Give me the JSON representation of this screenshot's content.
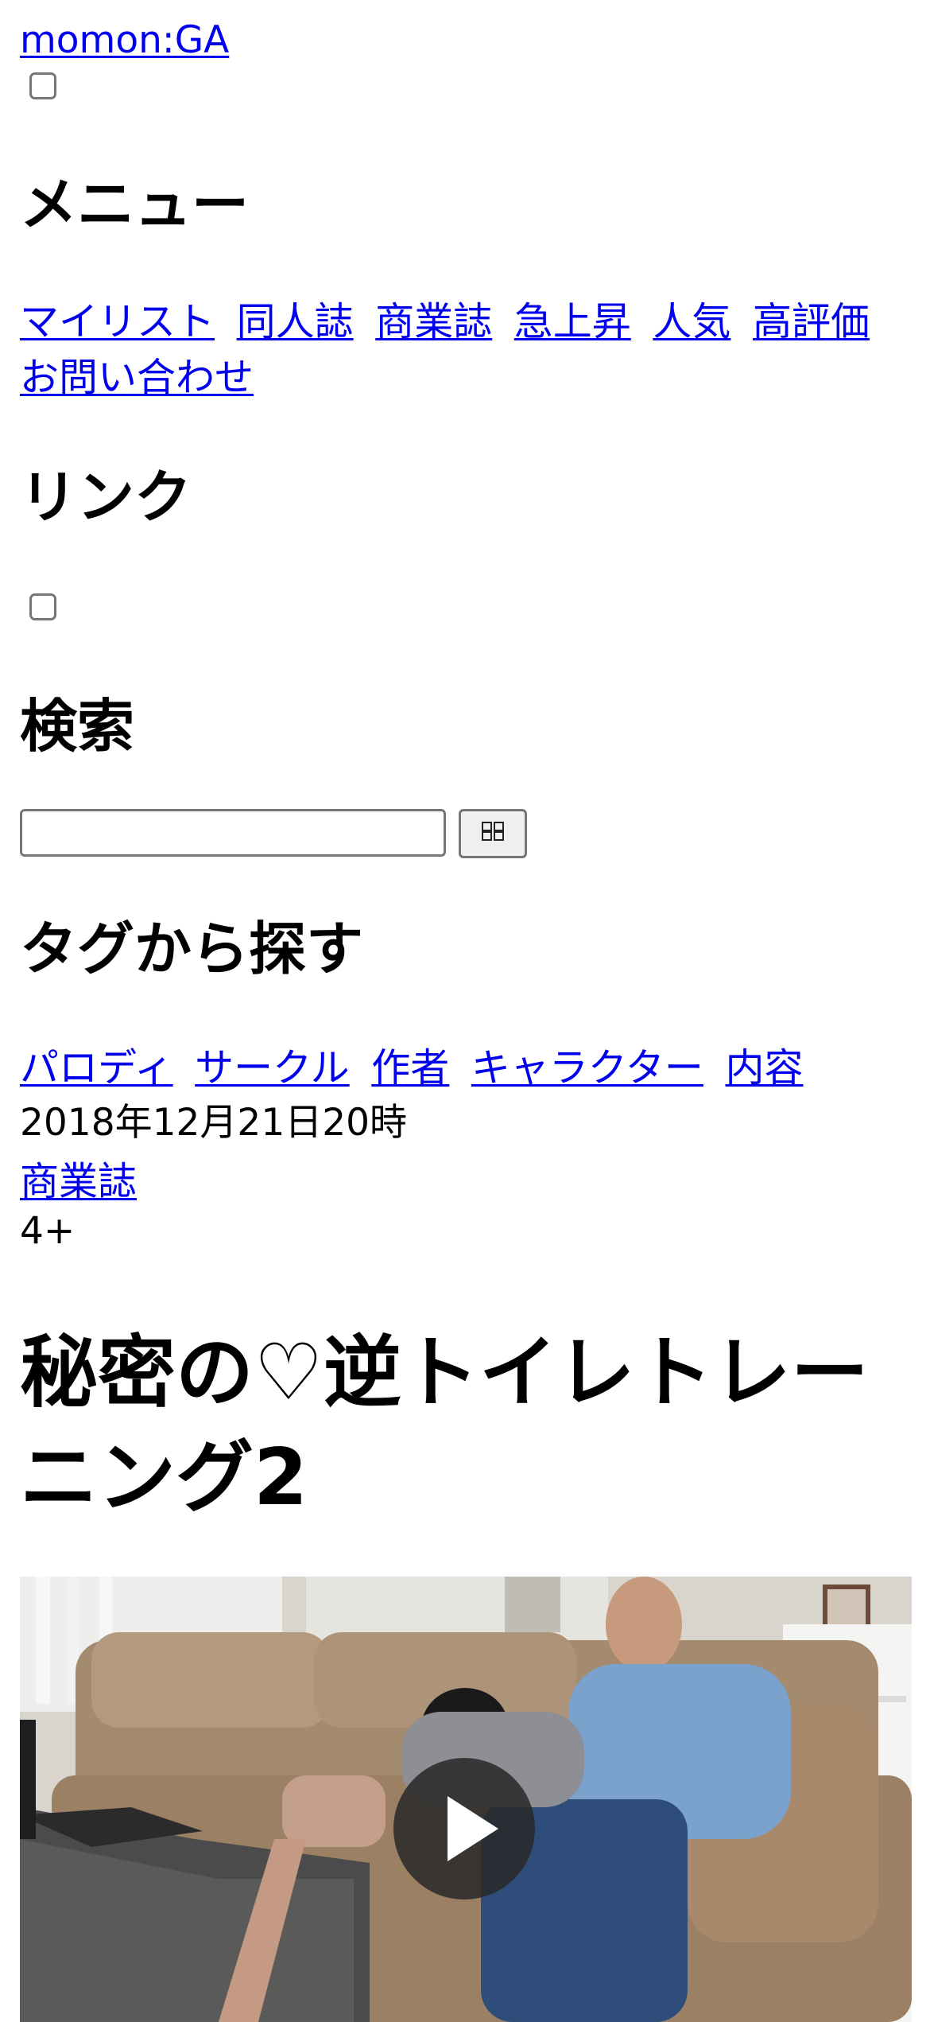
{
  "site": {
    "title": "momon:GA"
  },
  "menu": {
    "heading": "メニュー",
    "items": [
      {
        "label": "マイリスト"
      },
      {
        "label": "同人誌"
      },
      {
        "label": "商業誌"
      },
      {
        "label": "急上昇"
      },
      {
        "label": "人気"
      },
      {
        "label": "高評価"
      },
      {
        "label": "お問い合わせ"
      }
    ]
  },
  "links": {
    "heading": "リンク"
  },
  "search": {
    "heading": "検索",
    "value": "",
    "button_icon": "search-glyph-icon"
  },
  "tags": {
    "heading": "タグから探す",
    "items": [
      {
        "label": "パロディ"
      },
      {
        "label": "サークル"
      },
      {
        "label": "作者"
      },
      {
        "label": "キャラクター"
      },
      {
        "label": "内容"
      }
    ]
  },
  "post": {
    "date": "2018年12月21日20時",
    "category": "商業誌",
    "age_rating": "4+",
    "title": "秘密の♡逆トイレトレーニング2"
  },
  "video": {
    "play_icon": "play-icon"
  },
  "colors": {
    "link": "#0000ee",
    "play_button": "#282828"
  }
}
